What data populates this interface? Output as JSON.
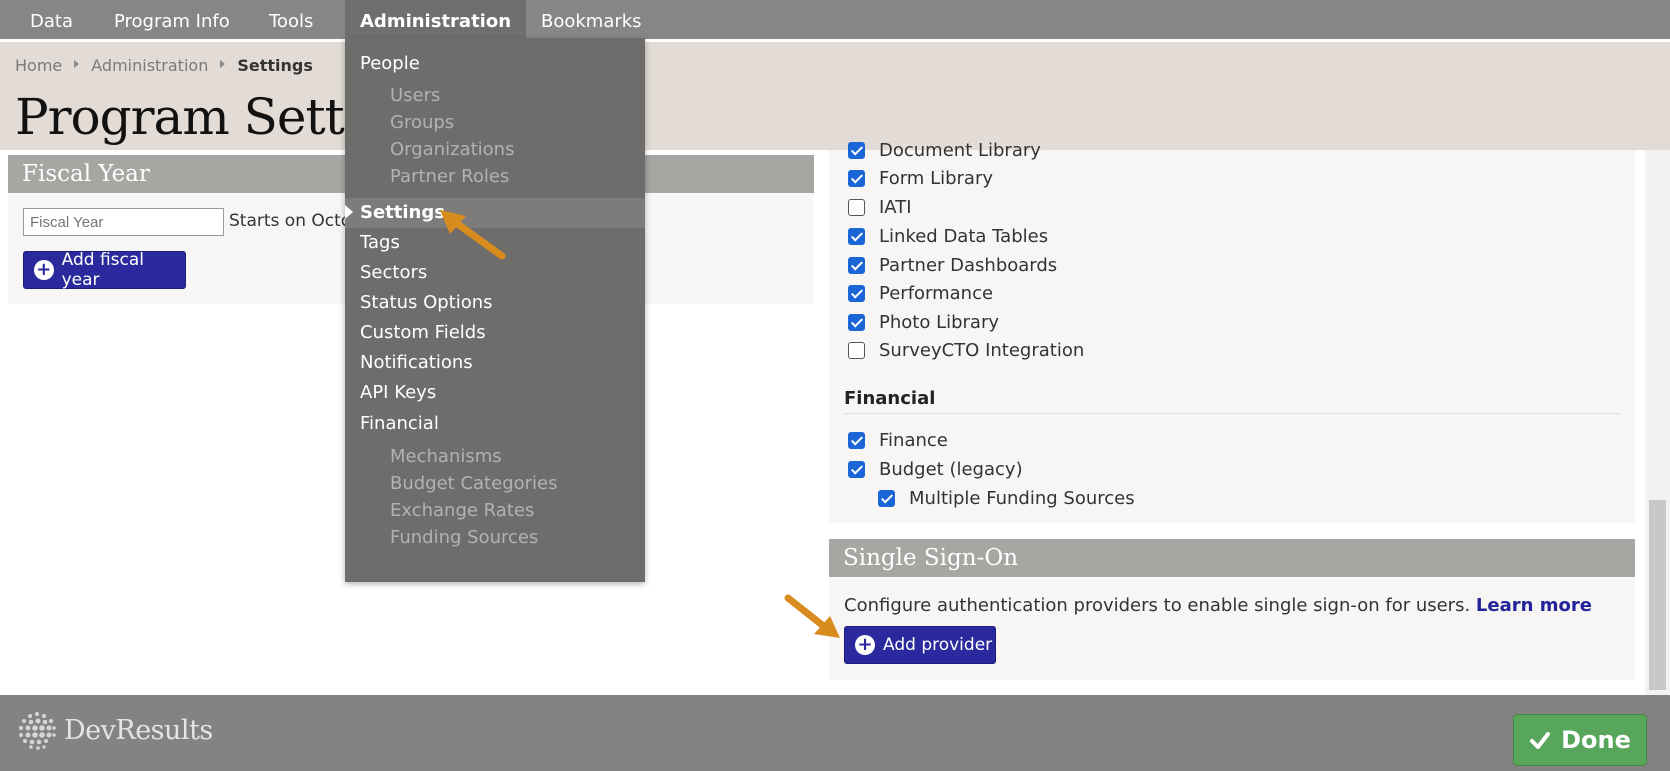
{
  "nav": {
    "items": [
      {
        "label": "Data"
      },
      {
        "label": "Program Info"
      },
      {
        "label": "Tools"
      },
      {
        "label": "Administration"
      },
      {
        "label": "Bookmarks"
      }
    ]
  },
  "breadcrumb": {
    "home": "Home",
    "admin": "Administration",
    "current": "Settings"
  },
  "page": {
    "title": "Program Settings"
  },
  "fiscal_year": {
    "heading": "Fiscal Year",
    "input_placeholder": "Fiscal Year",
    "starts_on": "Starts on Octo",
    "add_label": "Add fiscal year"
  },
  "features": {
    "items": [
      {
        "label": "Document Library",
        "checked": true
      },
      {
        "label": "Form Library",
        "checked": true
      },
      {
        "label": "IATI",
        "checked": false
      },
      {
        "label": "Linked Data Tables",
        "checked": true
      },
      {
        "label": "Partner Dashboards",
        "checked": true
      },
      {
        "label": "Performance",
        "checked": true
      },
      {
        "label": "Photo Library",
        "checked": true
      },
      {
        "label": "SurveyCTO Integration",
        "checked": false
      }
    ],
    "financial_heading": "Financial",
    "financial": [
      {
        "label": "Finance",
        "checked": true
      },
      {
        "label": "Budget (legacy)",
        "checked": true
      },
      {
        "label": "Multiple Funding Sources",
        "checked": true
      }
    ]
  },
  "sso": {
    "heading": "Single Sign-On",
    "description": "Configure authentication providers to enable single sign-on for users.",
    "learn_more": "Learn more",
    "add_label": "Add provider"
  },
  "menu": {
    "people": "People",
    "people_sub": [
      "Users",
      "Groups",
      "Organizations",
      "Partner Roles"
    ],
    "settings": "Settings",
    "items": [
      "Tags",
      "Sectors",
      "Status Options",
      "Custom Fields",
      "Notifications",
      "API Keys"
    ],
    "financial": "Financial",
    "financial_sub": [
      "Mechanisms",
      "Budget Categories",
      "Exchange Rates",
      "Funding Sources"
    ]
  },
  "footer": {
    "logo_text": "DevResults",
    "done_label": "Done"
  },
  "colors": {
    "accent": "#2a2a9e",
    "done": "#58a55c",
    "checkbox": "#1a66d6",
    "annotation_arrow": "#d98c1e"
  }
}
